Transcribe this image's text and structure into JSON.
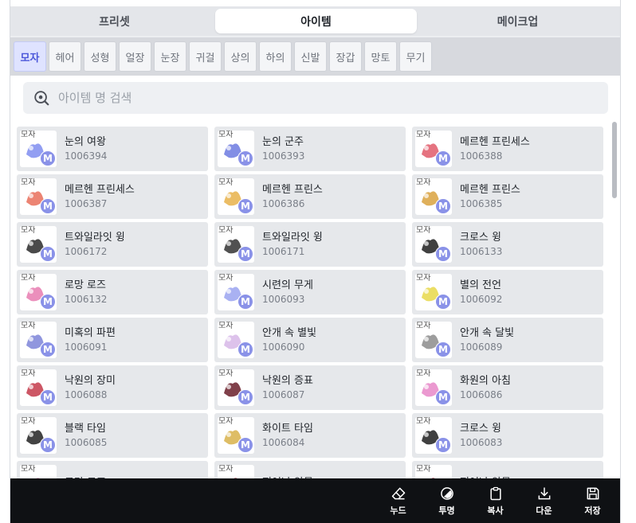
{
  "main_tabs": [
    {
      "label": "프리셋",
      "active": false
    },
    {
      "label": "아이템",
      "active": true
    },
    {
      "label": "메이크업",
      "active": false
    }
  ],
  "categories": [
    "모자",
    "헤어",
    "성형",
    "얼장",
    "눈장",
    "귀걸",
    "상의",
    "하의",
    "신발",
    "장갑",
    "망토",
    "무기"
  ],
  "active_category": "모자",
  "search": {
    "placeholder": "아이템 명 검색",
    "value": ""
  },
  "items": [
    {
      "name": "눈의 여왕",
      "id": "1006394",
      "tag": "모자",
      "badge": "M",
      "art": "#7f8df0"
    },
    {
      "name": "눈의 군주",
      "id": "1006393",
      "tag": "모자",
      "badge": "M",
      "art": "#6c7ae0"
    },
    {
      "name": "메르헨 프린세스",
      "id": "1006388",
      "tag": "모자",
      "badge": "M",
      "art": "#e05a6a"
    },
    {
      "name": "메르헨 프린세스",
      "id": "1006387",
      "tag": "모자",
      "badge": "M",
      "art": "#e96e5a"
    },
    {
      "name": "메르헨 프린스",
      "id": "1006386",
      "tag": "모자",
      "badge": "M",
      "art": "#e8b14a"
    },
    {
      "name": "메르헨 프린스",
      "id": "1006385",
      "tag": "모자",
      "badge": "M",
      "art": "#d9a23e"
    },
    {
      "name": "트와일라잇 윙",
      "id": "1006172",
      "tag": "모자",
      "badge": "M",
      "art": "#2a2a2a"
    },
    {
      "name": "트와일라잇 윙",
      "id": "1006171",
      "tag": "모자",
      "badge": "M",
      "art": "#333333"
    },
    {
      "name": "크로스 윙",
      "id": "1006133",
      "tag": "모자",
      "badge": "M",
      "art": "#1e1e1e"
    },
    {
      "name": "로망 로즈",
      "id": "1006132",
      "tag": "모자",
      "badge": "M",
      "art": "#e77bb0"
    },
    {
      "name": "시련의 무게",
      "id": "1006093",
      "tag": "모자",
      "badge": "M",
      "art": "#9aa3f0"
    },
    {
      "name": "별의 전언",
      "id": "1006092",
      "tag": "모자",
      "badge": "M",
      "art": "#e8d84a"
    },
    {
      "name": "미혹의 파편",
      "id": "1006091",
      "tag": "모자",
      "badge": "M",
      "art": "#7c84d8"
    },
    {
      "name": "안개 속 별빛",
      "id": "1006090",
      "tag": "모자",
      "badge": "M",
      "art": "#d7b7e8"
    },
    {
      "name": "안개 속 달빛",
      "id": "1006089",
      "tag": "모자",
      "badge": "M",
      "art": "#8c8c8c"
    },
    {
      "name": "낙원의 장미",
      "id": "1006088",
      "tag": "모자",
      "badge": "M",
      "art": "#c43a4a"
    },
    {
      "name": "낙원의 증표",
      "id": "1006087",
      "tag": "모자",
      "badge": "M",
      "art": "#6a1f2a"
    },
    {
      "name": "화원의 아침",
      "id": "1006086",
      "tag": "모자",
      "badge": "M",
      "art": "#e887c8"
    },
    {
      "name": "블랙 타임",
      "id": "1006085",
      "tag": "모자",
      "badge": "M",
      "art": "#222222"
    },
    {
      "name": "화이트 타임",
      "id": "1006084",
      "tag": "모자",
      "badge": "M",
      "art": "#d8b24a"
    },
    {
      "name": "크로스 윙",
      "id": "1006083",
      "tag": "모자",
      "badge": "M",
      "art": "#1e1e1e"
    },
    {
      "name": "로망 로즈",
      "id": "",
      "tag": "모자",
      "badge": "M",
      "art": "#e77bb0"
    },
    {
      "name": "피어난 악몽",
      "id": "",
      "tag": "모자",
      "badge": "M",
      "art": "#8a1a2a"
    },
    {
      "name": "피어난 악몽",
      "id": "",
      "tag": "모자",
      "badge": "M",
      "art": "#8a1a2a"
    }
  ],
  "toolbar": [
    {
      "label": "누드",
      "icon": "eraser-icon"
    },
    {
      "label": "투명",
      "icon": "transparency-icon"
    },
    {
      "label": "복사",
      "icon": "clipboard-icon"
    },
    {
      "label": "다운",
      "icon": "download-icon"
    },
    {
      "label": "저장",
      "icon": "save-icon"
    }
  ],
  "colors": {
    "accent": "#4a56d9",
    "badge": "#8a92e8",
    "toolbar_bg": "#0f1114"
  }
}
